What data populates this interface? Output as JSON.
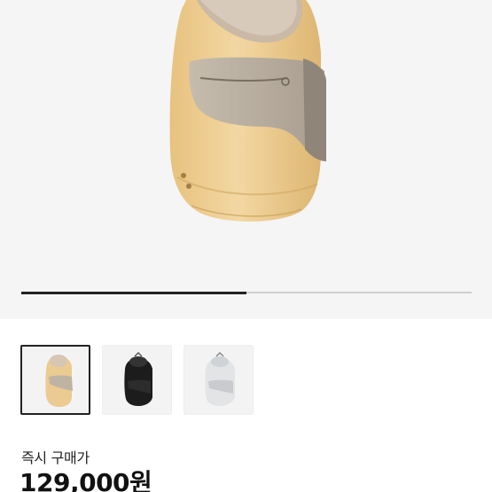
{
  "gallery": {
    "image_count": 3,
    "progress_fraction": 0.5,
    "thumbnails": [
      {
        "color_name": "beige",
        "selected": true
      },
      {
        "color_name": "black",
        "selected": false
      },
      {
        "color_name": "light-gray",
        "selected": false
      }
    ]
  },
  "purchase": {
    "label": "즉시 구매가",
    "price": "129,000원"
  },
  "colors": {
    "hero_bg": "#f5f5f5",
    "progress_active": "#222222",
    "progress_track": "#cfcfcf",
    "product_beige": "#e9c98e",
    "product_mesh": "#b9aea0"
  }
}
